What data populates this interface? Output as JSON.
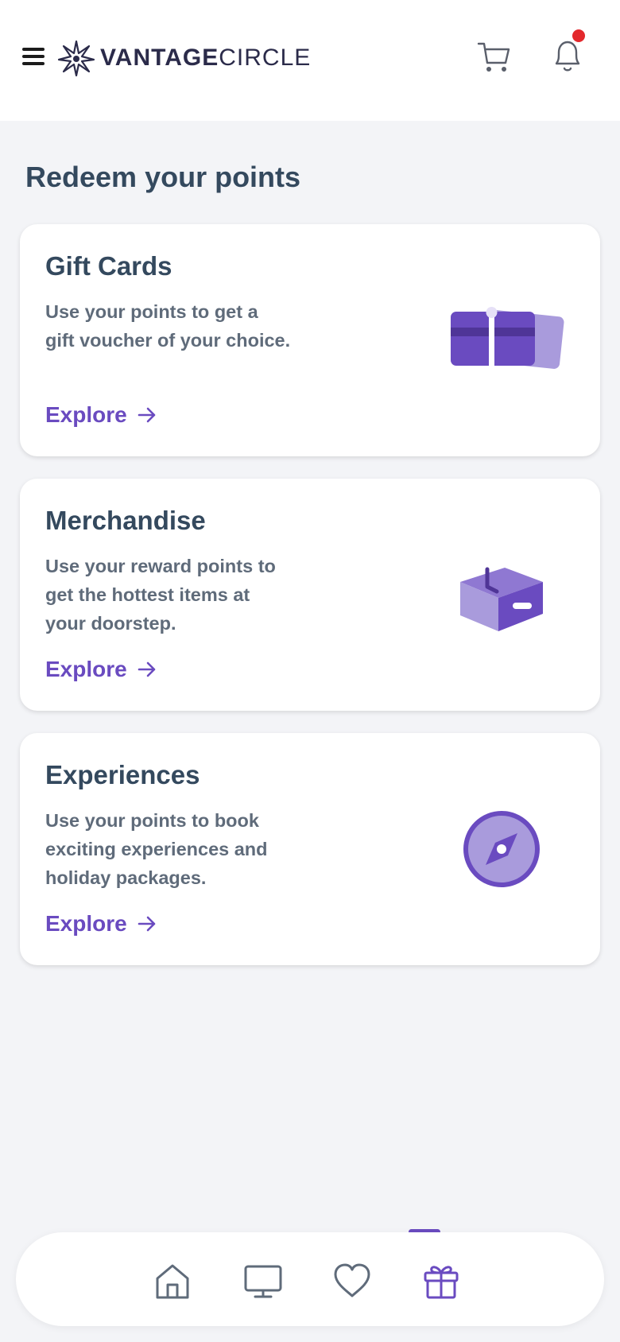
{
  "header": {
    "logo_text_bold": "VANTAGE",
    "logo_text_light": "CIRCLE",
    "icons": [
      "menu-icon",
      "logo-star-icon",
      "cart-icon",
      "bell-icon"
    ],
    "notification_dot_color": "#e3282c"
  },
  "page": {
    "title": "Redeem your points"
  },
  "cards": [
    {
      "title": "Gift Cards",
      "description": "Use your points to get a gift voucher of your choice.",
      "link": "Explore",
      "icon": "gift-card-icon"
    },
    {
      "title": "Merchandise",
      "description": "Use your reward points to get the hottest items at your doorstep.",
      "link": "Explore",
      "icon": "box-icon"
    },
    {
      "title": "Experiences",
      "description": "Use your points to book exciting experiences and holiday packages.",
      "link": "Explore",
      "icon": "compass-icon"
    }
  ],
  "bottom_nav": {
    "items": [
      "home-icon",
      "monitor-icon",
      "heart-icon",
      "gift-icon"
    ],
    "active": "gift-icon"
  },
  "colors": {
    "accent": "#6a4bc0",
    "accent_light": "#a99bdc",
    "heading": "#34495e",
    "body_text": "#5f6b7a",
    "background": "#f3f4f7"
  }
}
